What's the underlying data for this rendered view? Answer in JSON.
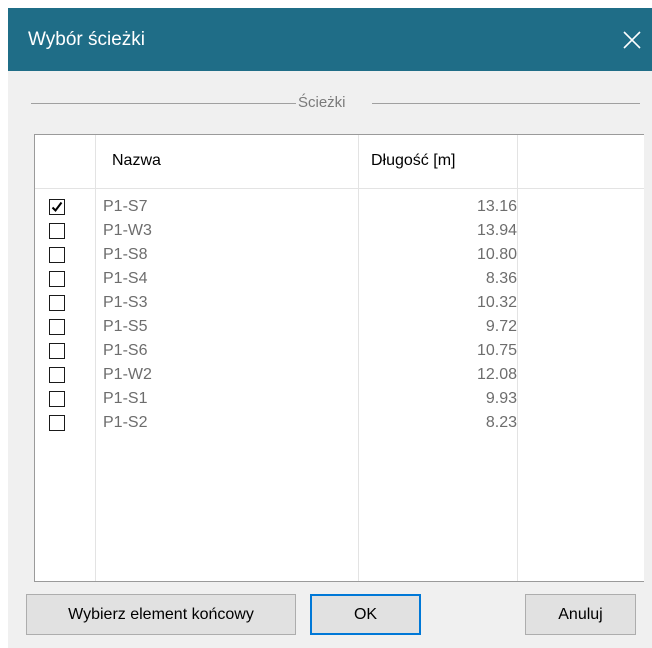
{
  "window": {
    "title": "Wybór ścieżki"
  },
  "group": {
    "label": "Ścieżki"
  },
  "table": {
    "headers": [
      "Nazwa",
      "Długość [m]"
    ],
    "rows": [
      {
        "checked": true,
        "name": "P1-S7",
        "length": "13.16"
      },
      {
        "checked": false,
        "name": "P1-W3",
        "length": "13.94"
      },
      {
        "checked": false,
        "name": "P1-S8",
        "length": "10.80"
      },
      {
        "checked": false,
        "name": "P1-S4",
        "length": "8.36"
      },
      {
        "checked": false,
        "name": "P1-S3",
        "length": "10.32"
      },
      {
        "checked": false,
        "name": "P1-S5",
        "length": "9.72"
      },
      {
        "checked": false,
        "name": "P1-S6",
        "length": "10.75"
      },
      {
        "checked": false,
        "name": "P1-W2",
        "length": "12.08"
      },
      {
        "checked": false,
        "name": "P1-S1",
        "length": "9.93"
      },
      {
        "checked": false,
        "name": "P1-S2",
        "length": "8.23"
      }
    ]
  },
  "buttons": {
    "select_end": "Wybierz element końcowy",
    "ok": "OK",
    "cancel": "Anuluj"
  },
  "icons": {
    "close": "close-icon",
    "check": "checkmark-icon"
  },
  "colors": {
    "titlebar": "#1f6d87",
    "default_button_border": "#0078d7"
  }
}
